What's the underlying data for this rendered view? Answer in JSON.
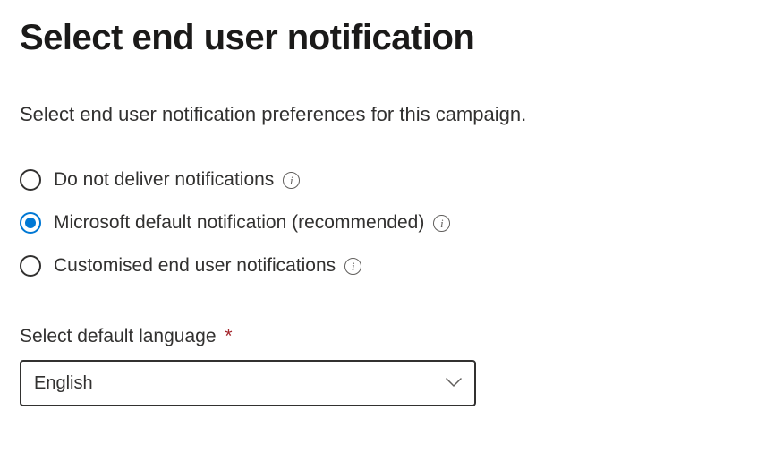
{
  "heading": "Select end user notification",
  "description": "Select end user notification preferences for this campaign.",
  "options": {
    "opt0": {
      "label": "Do not deliver notifications",
      "selected": false
    },
    "opt1": {
      "label": "Microsoft default notification (recommended)",
      "selected": true
    },
    "opt2": {
      "label": "Customised end user notifications",
      "selected": false
    }
  },
  "language": {
    "label": "Select default language",
    "required_marker": "*",
    "value": "English"
  }
}
